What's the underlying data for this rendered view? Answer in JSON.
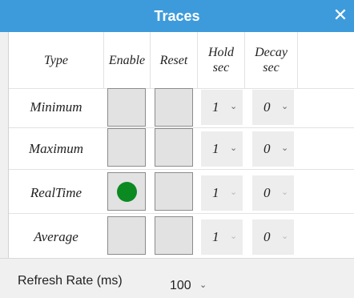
{
  "window": {
    "title": "Traces",
    "close_glyph": "✕"
  },
  "table": {
    "headers": {
      "type": "Type",
      "enable": "Enable",
      "reset": "Reset",
      "hold": [
        "Hold",
        "sec"
      ],
      "decay": [
        "Decay",
        "sec"
      ]
    },
    "rows": [
      {
        "label": "Minimum",
        "enabled": false,
        "hold": "1",
        "decay": "0",
        "hold_disabled": false,
        "decay_disabled": false
      },
      {
        "label": "Maximum",
        "enabled": false,
        "hold": "1",
        "decay": "0",
        "hold_disabled": false,
        "decay_disabled": false
      },
      {
        "label": "RealTime",
        "enabled": true,
        "hold": "1",
        "decay": "0",
        "hold_disabled": true,
        "decay_disabled": true
      },
      {
        "label": "Average",
        "enabled": false,
        "hold": "1",
        "decay": "0",
        "hold_disabled": true,
        "decay_disabled": true
      }
    ],
    "chevron_glyph": "⌄"
  },
  "footer": {
    "refresh_label": "Refresh Rate (ms)",
    "refresh_value": "100"
  },
  "colors": {
    "title_bar": "#3d9bdb",
    "enabled_dot": "#0b8a22"
  }
}
